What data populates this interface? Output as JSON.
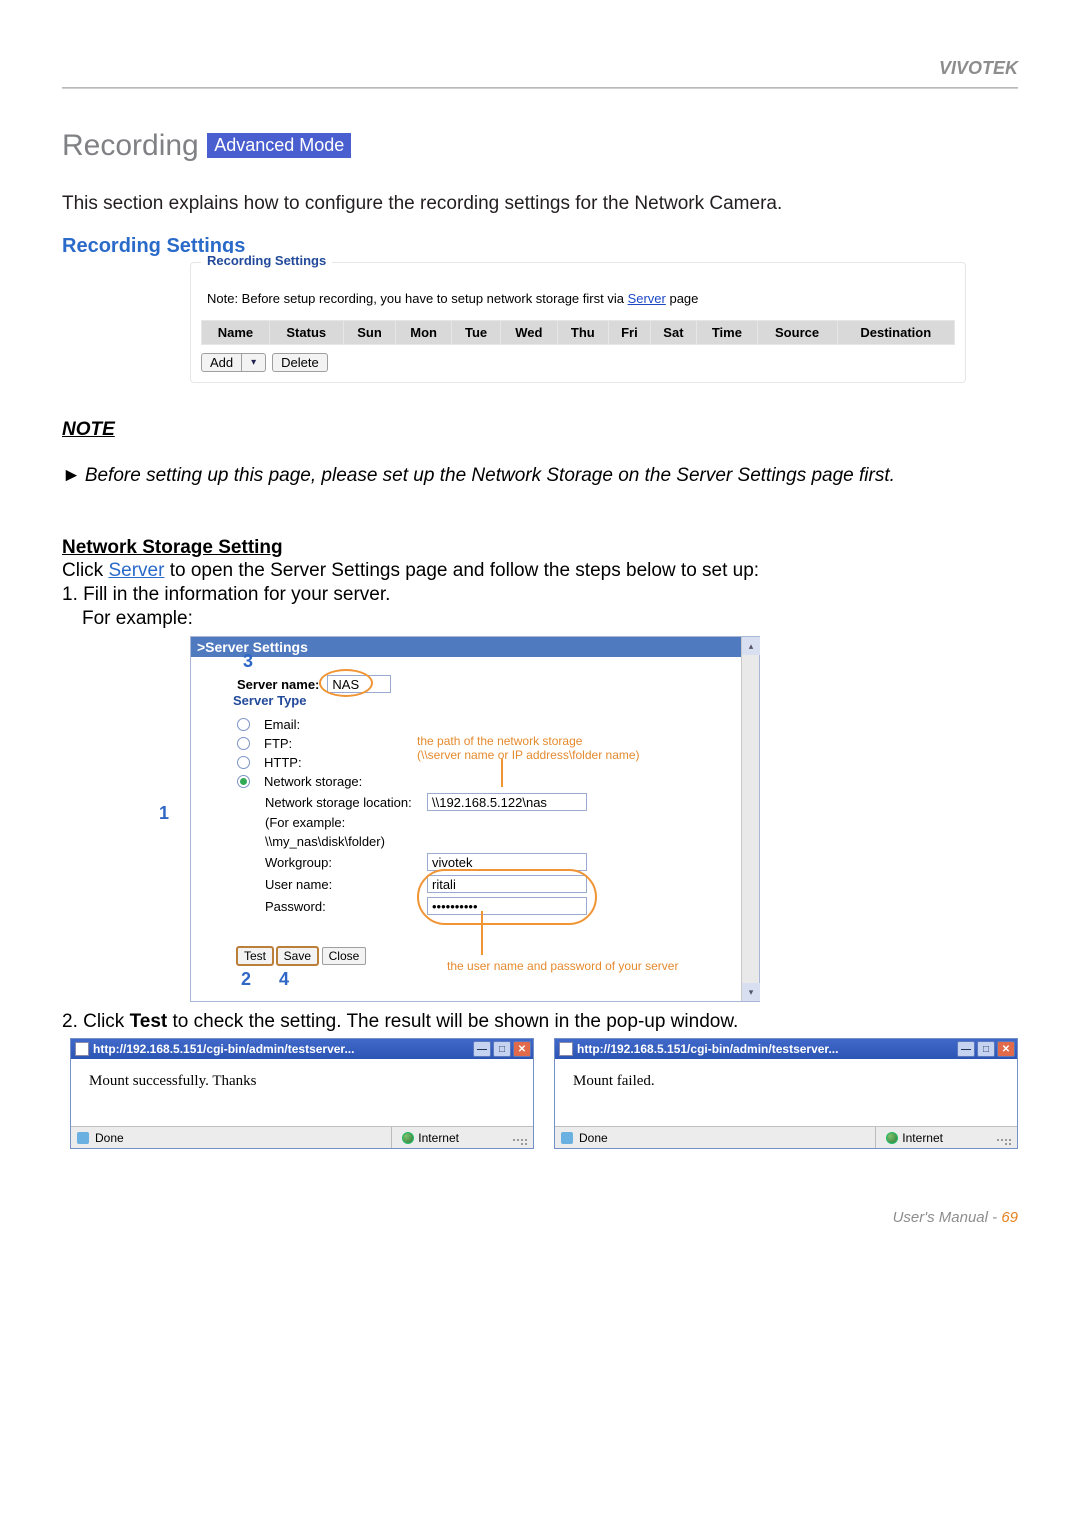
{
  "brand": "VIVOTEK",
  "section": {
    "title": "Recording",
    "mode_badge": "Advanced Mode",
    "intro": "This section explains how to configure the recording settings for the Network Camera.",
    "subsection": "Recording Settings"
  },
  "recording_panel": {
    "legend": "Recording Settings",
    "note_prefix": "Note: Before setup recording, you have to setup network storage first via ",
    "note_link": "Server",
    "note_suffix": " page",
    "columns": [
      "Name",
      "Status",
      "Sun",
      "Mon",
      "Tue",
      "Wed",
      "Thu",
      "Fri",
      "Sat",
      "Time",
      "Source",
      "Destination"
    ],
    "btn_add": "Add",
    "btn_delete": "Delete"
  },
  "note": {
    "heading": "NOTE",
    "body": "Before setting up this page, please set up the Network Storage on the Server Settings page first."
  },
  "network_storage": {
    "heading": "Network Storage Setting",
    "line_pre": "Click ",
    "line_link": "Server",
    "line_post": " to open the Server Settings page and follow the steps below to set up:",
    "step1": "1. Fill in the information for your server.",
    "step1_sub": "For example:"
  },
  "server_settings": {
    "header": ">Server Settings",
    "server_name_label": "Server name:",
    "server_name_value": "NAS",
    "legend": "Server Type",
    "opt_email": "Email:",
    "opt_ftp": "FTP:",
    "opt_http": "HTTP:",
    "opt_ns": "Network storage:",
    "ns_location_label": "Network storage location:",
    "ns_location_value": "\\\\192.168.5.122\\nas",
    "eg_label": "(For example:",
    "eg_value": "\\\\my_nas\\disk\\folder)",
    "workgroup_label": "Workgroup:",
    "workgroup_value": "vivotek",
    "username_label": "User name:",
    "username_value": "ritali",
    "password_label": "Password:",
    "password_value": "••••••••••",
    "btn_test": "Test",
    "btn_save": "Save",
    "btn_close": "Close",
    "ann_path1": "the path of the network storage",
    "ann_path2": "(\\\\server name or IP address\\folder name)",
    "ann_user": "the user name and password of your server",
    "callout1": "1",
    "callout2": "2",
    "callout3": "3",
    "callout4": "4"
  },
  "step2_pre": "2. Click ",
  "step2_bold": "Test",
  "step2_post": " to check the setting. The result will be shown in the pop-up window.",
  "popup": {
    "title": "http://192.168.5.151/cgi-bin/admin/testserver...",
    "success_msg": "Mount successfully. Thanks",
    "fail_msg": "Mount failed.",
    "status_done": "Done",
    "status_zone": "Internet"
  },
  "footer": {
    "label": "User's Manual - ",
    "page": "69"
  }
}
